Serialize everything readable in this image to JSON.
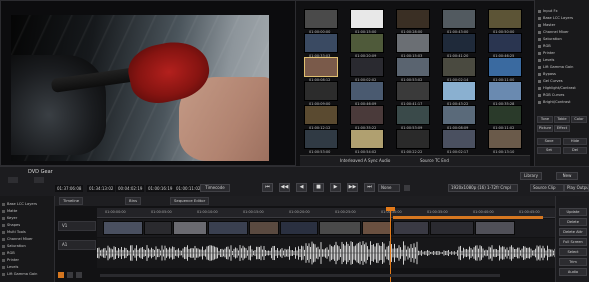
{
  "bin": {
    "rows": [
      {
        "timecodes": [
          "01:00:00:00",
          "01:00:15:00",
          "01:00:28:00",
          "01:00:43:00",
          "01:00:50:00"
        ],
        "colors": [
          "#4a4a4a",
          "#e8e8e8",
          "#3a2f24",
          "#525a60",
          "#5c5436"
        ]
      },
      {
        "timecodes": [
          "01:00:33:03",
          "01:00:20:09",
          "01:00:15:03",
          "01:00:41:20",
          "01:00:46:25"
        ],
        "colors": [
          "#3a4a62",
          "#4f5a3a",
          "#6b6f74",
          "#1f2a3a",
          "#2a3550"
        ]
      },
      {
        "timecodes": [
          "01:00:08:12",
          "01:00:02:02",
          "01:00:53:02",
          "01:00:02:14",
          "01:00:11:00"
        ],
        "colors": [
          "#7a5a4a",
          "#2a2a30",
          "#5a6470",
          "#4a4a40",
          "#3a6aa0"
        ]
      },
      {
        "timecodes": [
          "01:00:09:00",
          "01:00:46:09",
          "01:00:41:17",
          "01:00:43:22",
          "01:00:35:28"
        ],
        "colors": [
          "#2c2c2c",
          "#4a5a70",
          "#3a3a3a",
          "#8ab0d0",
          "#6a8ab0"
        ]
      },
      {
        "timecodes": [
          "01:00:12:12",
          "01:00:35:22",
          "01:00:53:09",
          "01:00:08:09",
          "01:00:11:02"
        ],
        "colors": [
          "#5a4a30",
          "#4a3a3a",
          "#3a4a4a",
          "#5a6a7a",
          "#2a3a2a"
        ]
      },
      {
        "timecodes": [
          "01:00:53:00",
          "01:00:54:02",
          "01:00:22:22",
          "01:00:02:17",
          "01:00:13:10"
        ],
        "colors": [
          "#303a44",
          "#b0a070",
          "#2a2a2a",
          "#4a5060",
          "#6a5a4a"
        ]
      }
    ],
    "footer_left": "Interleaved A Sync Audio",
    "footer_right": "Source TC End"
  },
  "effects_panel": {
    "items": [
      "Input Fx",
      "Base LCC Layers",
      "Master",
      "Channel Mixer",
      "Saturation",
      "RGB",
      "Printer",
      "Levels",
      "Lift Gamma Gain",
      "Bypass",
      "Gel Curves",
      "Highlight/Contrast",
      "RGB Curves",
      "Bright/Contrast"
    ],
    "tab_labels": [
      "Tone",
      "Table",
      "Color",
      "Picture",
      "Effect"
    ],
    "button_labels": [
      "Save",
      "Hide",
      "Set",
      "Del"
    ]
  },
  "toolbar": {
    "dvd_label": "DVD Gear",
    "timecodes": [
      "01:37:06:08",
      "01:34:13:02",
      "00:04:02:19",
      "01:00:16:19",
      "01:00:11:02"
    ],
    "sub_labels": [
      "In",
      "Out",
      "Length",
      "Dur"
    ],
    "timecode_button": "Timecode",
    "transport": [
      "⏮",
      "◀◀",
      "◀",
      "■",
      "▶",
      "▶▶",
      "⏭"
    ],
    "none_select": "None",
    "format_select": "1920x1080p (16) 1-72fr Cmpl",
    "source_clip": "Source Clip",
    "play_output": "Play Output",
    "library_btn": "Library",
    "new_btn": "New"
  },
  "timeline": {
    "tabs": [
      "Timeline",
      "Bins",
      "Sequence Editor"
    ],
    "ruler_marks": [
      "01:00:00:00",
      "01:00:05:00",
      "01:00:10:00",
      "01:00:15:00",
      "01:00:20:00",
      "01:00:25:00",
      "01:00:30:00",
      "01:00:35:00",
      "01:00:40:00",
      "01:00:45:00"
    ],
    "tracks": [
      "V1",
      "A1"
    ],
    "clip_colors": [
      "#4a5060",
      "#2a2a2e",
      "#6a6a70",
      "#3a4050",
      "#5a4a40",
      "#2a3040",
      "#4a4a4a",
      "#6a5040",
      "#3a3a44",
      "#2a2a30",
      "#505058"
    ]
  },
  "left_effects": {
    "items": [
      "Base LCC Layers",
      "Matte",
      "Keyer",
      "Shapes",
      "Multi Tools",
      "Channel Mixer",
      "Saturation",
      "RGB",
      "Printer",
      "Levels",
      "Lift Gamma Gain"
    ]
  },
  "bottom_right": {
    "buttons": [
      "Update",
      "Delete",
      "Delete Attr",
      "Full Screen",
      "Select",
      "Trim",
      "Audio"
    ]
  }
}
